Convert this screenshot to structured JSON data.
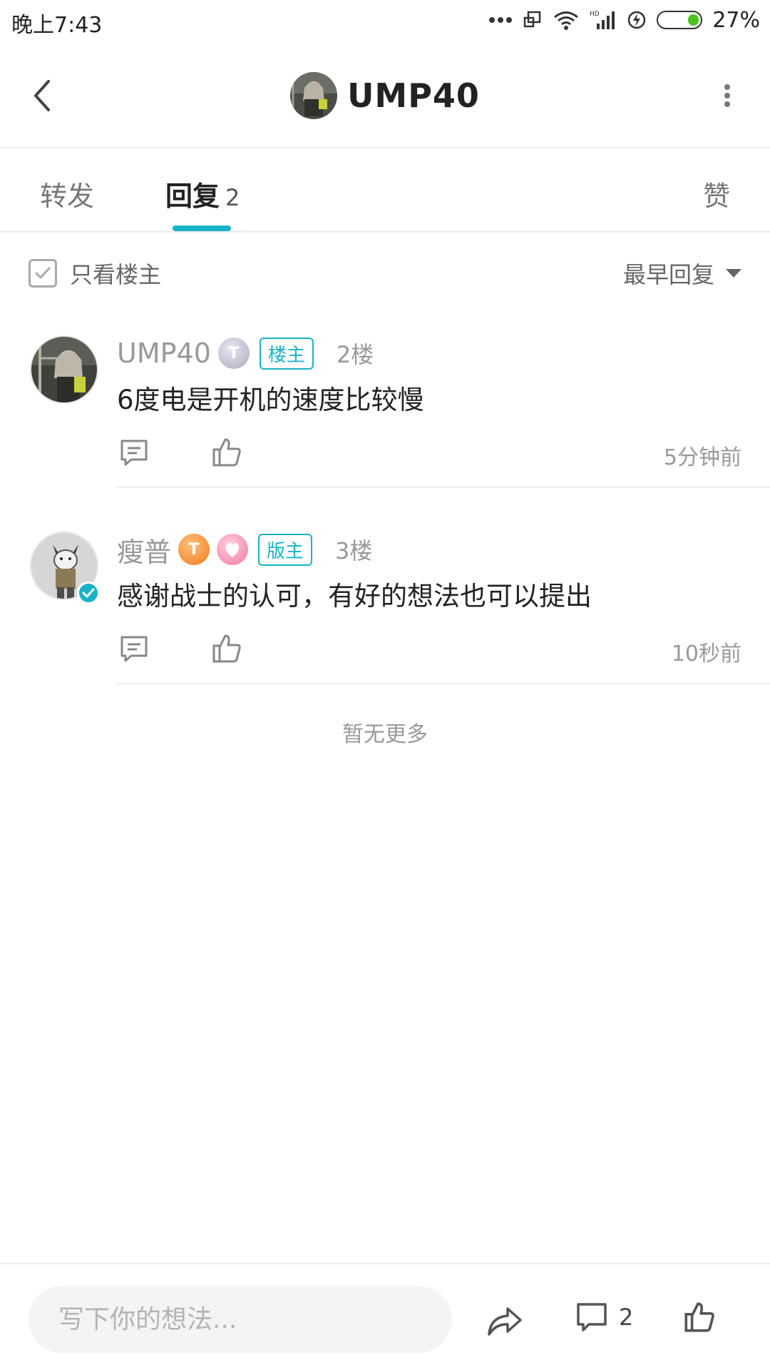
{
  "status_bar": {
    "time": "晚上7:43",
    "battery_percent_label": "27%",
    "battery_level": 0.27,
    "battery_color": "#4cc21c"
  },
  "header": {
    "title": "UMP40",
    "back_icon": "chevron-left-icon",
    "more_icon": "more-vertical-icon"
  },
  "tabs": {
    "forward_label": "转发",
    "reply_label": "回复",
    "reply_count": "2",
    "like_label": "赞",
    "active_color": "#19b3c6"
  },
  "filter": {
    "only_op_label": "只看楼主",
    "only_op_checked": true,
    "sort_label": "最早回复"
  },
  "comments": [
    {
      "name": "UMP40",
      "medal": "T",
      "role": "楼主",
      "floor": "2楼",
      "text": "6度电是开机的速度比较慢",
      "time": "5分钟前"
    },
    {
      "name": "瘦普",
      "medal": "T",
      "role": "版主",
      "floor": "3楼",
      "text": "感谢战士的认可，有好的想法也可以提出",
      "time": "10秒前",
      "verified": true
    }
  ],
  "footer_note": "暂无更多",
  "bottom_bar": {
    "input_placeholder": "写下你的想法...",
    "comment_count": "2"
  }
}
